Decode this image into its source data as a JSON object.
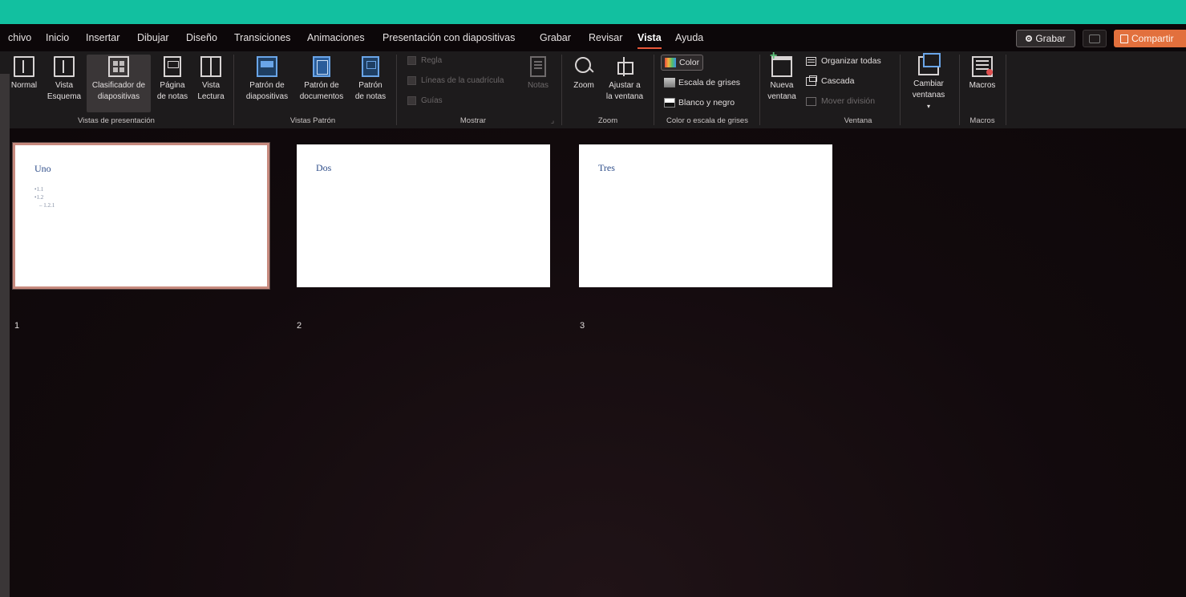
{
  "menubar": {
    "tabs": [
      {
        "label": "chivo"
      },
      {
        "label": "Inicio"
      },
      {
        "label": "Insertar"
      },
      {
        "label": "Dibujar"
      },
      {
        "label": "Diseño"
      },
      {
        "label": "Transiciones"
      },
      {
        "label": "Animaciones"
      },
      {
        "label": "Presentación con diapositivas"
      },
      {
        "label": "Grabar"
      },
      {
        "label": "Revisar"
      },
      {
        "label": "Vista"
      },
      {
        "label": "Ayuda"
      }
    ],
    "active_tab": "Vista",
    "record_label": "Grabar",
    "share_label": "Compartir"
  },
  "ribbon": {
    "presentation_views": {
      "label": "Vistas de presentación",
      "normal": "Normal",
      "outline": "Vista\nEsquema",
      "sorter": "Clasificador de\ndiapositivas",
      "notes_page": "Página\nde notas",
      "reading": "Vista\nLectura"
    },
    "master_views": {
      "label": "Vistas Patrón",
      "slide_master": "Patrón de\ndiapositivas",
      "handout_master": "Patrón de\ndocumentos",
      "notes_master": "Patrón\nde notas"
    },
    "show": {
      "label": "Mostrar",
      "ruler": "Regla",
      "gridlines": "Líneas de la cuadrícula",
      "guides": "Guías",
      "notes": "Notas"
    },
    "zoom": {
      "label": "Zoom",
      "zoom": "Zoom",
      "fit": "Ajustar a\nla ventana"
    },
    "color": {
      "label": "Color o escala de grises",
      "color": "Color",
      "grayscale": "Escala de grises",
      "bw": "Blanco y negro"
    },
    "window": {
      "label": "Ventana",
      "new_window": "Nueva\nventana",
      "arrange_all": "Organizar todas",
      "cascade": "Cascada",
      "move_split": "Mover división",
      "switch": "Cambiar\nventanas"
    },
    "macros": {
      "label": "Macros",
      "macros": "Macros"
    }
  },
  "slides": [
    {
      "number": "1",
      "title": "Uno",
      "bullets": [
        "•1.1",
        "•1.2",
        "   – 1.2.1"
      ]
    },
    {
      "number": "2",
      "title": "Dos",
      "bullets": []
    },
    {
      "number": "3",
      "title": "Tres",
      "bullets": []
    }
  ],
  "colors": {
    "titlebar": "#12c0a0",
    "accent_share": "#e2703d",
    "active_tab_underline": "#e8573a",
    "slide_title": "#2f4e8a"
  }
}
